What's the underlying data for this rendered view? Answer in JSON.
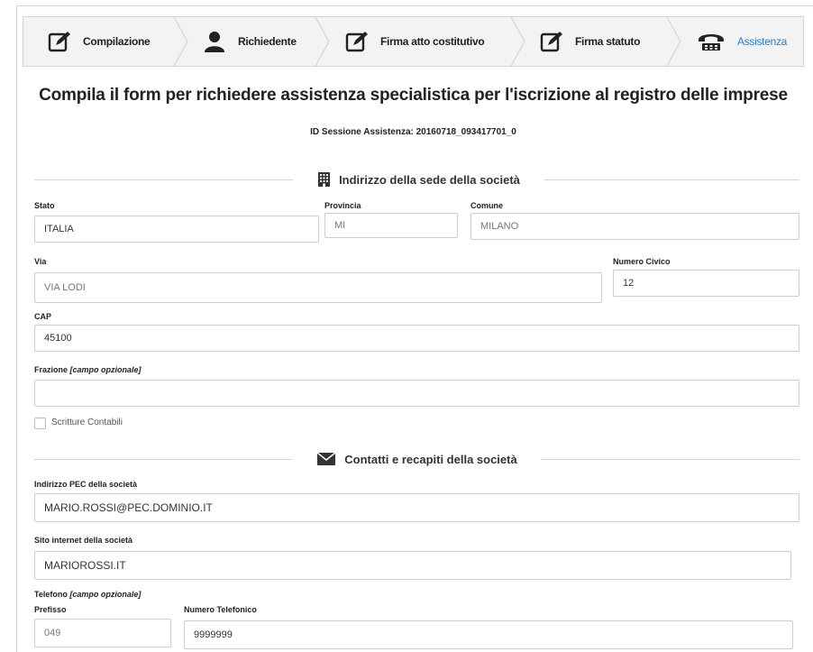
{
  "steps": [
    {
      "label": "Compilazione",
      "icon": "edit-icon"
    },
    {
      "label": "Richiedente",
      "icon": "user-icon"
    },
    {
      "label": "Firma atto costitutivo",
      "icon": "edit-icon"
    },
    {
      "label": "Firma statuto",
      "icon": "edit-icon"
    },
    {
      "label": "Assistenza",
      "icon": "telephone-icon"
    }
  ],
  "page": {
    "title": "Compila il form per richiedere assistenza specialistica per l'iscrizione al registro delle imprese",
    "session_id": "ID Sessione Assistenza: 20160718_093417701_0"
  },
  "section_address": {
    "heading": "Indirizzo della sede della società",
    "stato_label": "Stato",
    "stato_value": "ITALIA",
    "provincia_label": "Provincia",
    "provincia_value": "MI",
    "comune_label": "Comune",
    "comune_value": "MILANO",
    "via_label": "Via",
    "via_value": "VIA LODI",
    "civico_label": "Numero Civico",
    "civico_value": "12",
    "cap_label": "CAP",
    "cap_value": "45100",
    "frazione_label": "Frazione",
    "frazione_optional": "[campo opzionale]",
    "frazione_value": "",
    "scritture_label": "Scritture Contabili"
  },
  "section_contacts": {
    "heading": "Contatti e recapiti della società",
    "pec_label": "Indirizzo PEC della società",
    "pec_value": "MARIO.ROSSI@PEC.DOMINIO.IT",
    "sito_label": "Sito internet della società",
    "sito_value": "MARIOROSSI.IT",
    "telefono_label": "Telefono",
    "telefono_optional": "[campo opzionale]",
    "prefisso_label": "Prefisso",
    "prefisso_value": "049",
    "numero_label": "Numero Telefonico",
    "numero_value": "9999999"
  },
  "colors": {
    "accent": "#2d7fc1",
    "border": "#cccccc",
    "stepbar_bg": "#f3f3f3"
  }
}
